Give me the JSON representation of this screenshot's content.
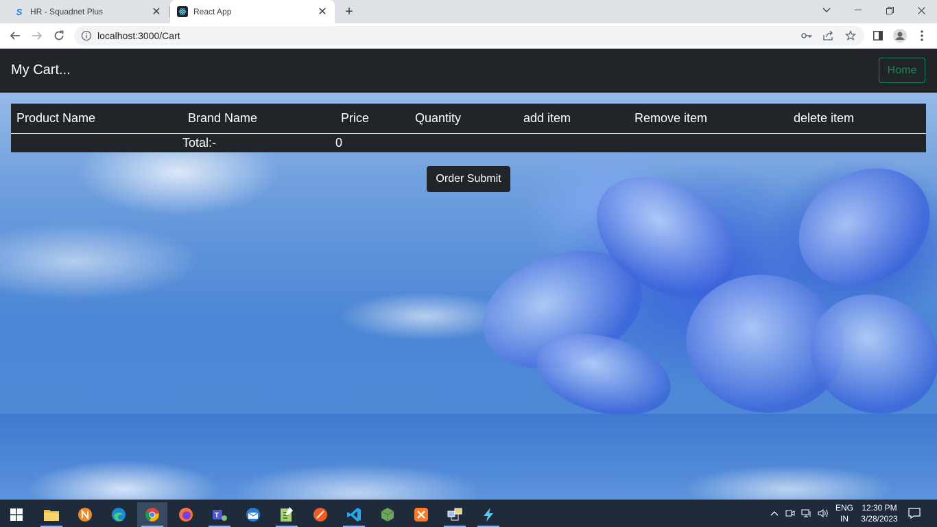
{
  "browser": {
    "tabs": [
      {
        "title": "HR - Squadnet Plus",
        "favicon": "S"
      },
      {
        "title": "React App",
        "favicon": "react-icon"
      }
    ],
    "url": "localhost:3000/Cart"
  },
  "navbar": {
    "brand": "My Cart...",
    "home_label": "Home"
  },
  "cart": {
    "headers": [
      "Product Name",
      "Brand Name",
      "Price",
      "Quantity",
      "add item",
      "Remove item",
      "delete item"
    ],
    "total_label": "Total:-",
    "total_value": "0",
    "order_submit_label": "Order Submit"
  },
  "taskbar": {
    "lang_top": "ENG",
    "lang_bottom": "IN",
    "time": "12:30 PM",
    "date": "3/28/2023"
  },
  "colors": {
    "navbar_bg": "#212529",
    "home_outline": "#198754"
  }
}
